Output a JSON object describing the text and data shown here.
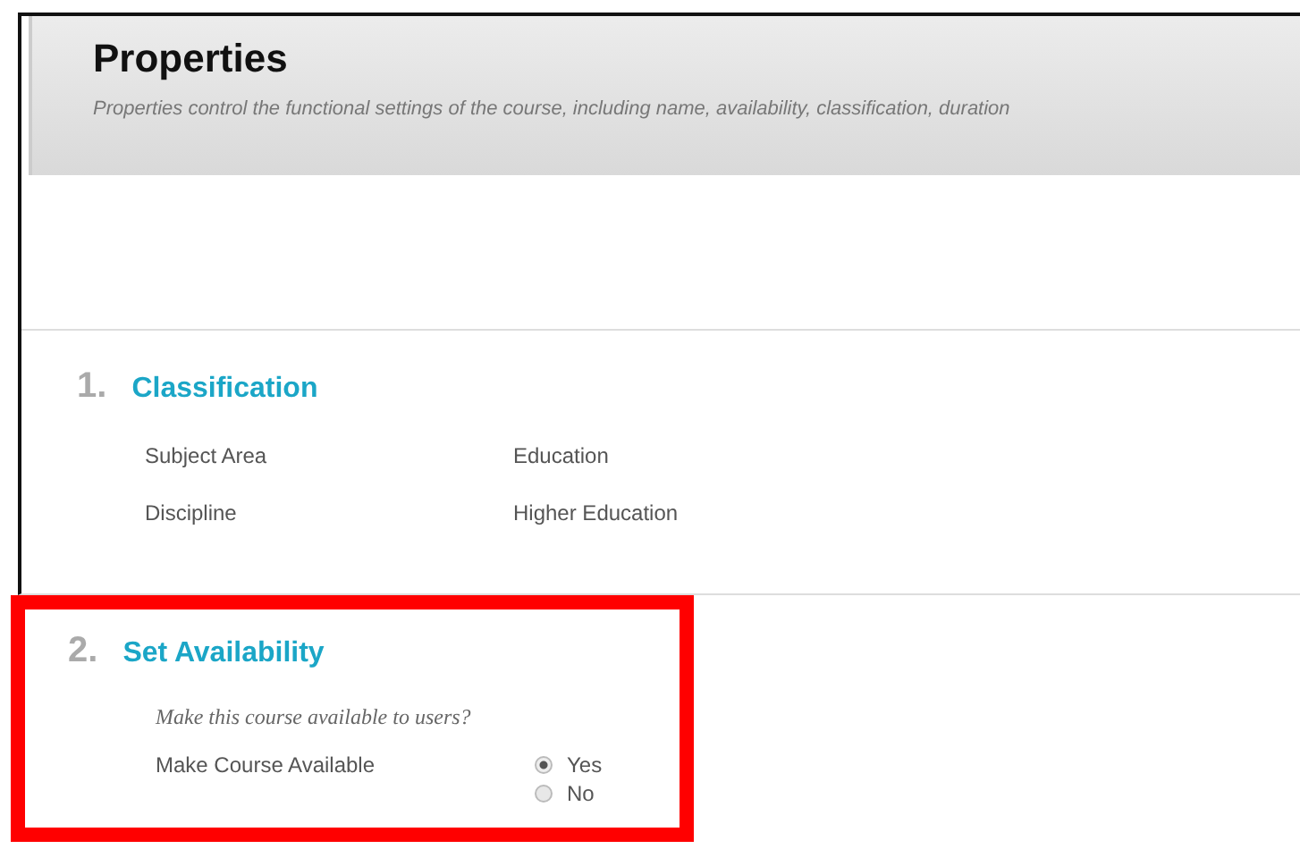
{
  "header": {
    "title": "Properties",
    "description": "Properties control the functional settings of the course, including name, availability, classification, duration"
  },
  "sections": [
    {
      "number": "1.",
      "title": "Classification",
      "highlighted": false,
      "fields": [
        {
          "kind": "text",
          "label": "Subject Area",
          "value": "Education"
        },
        {
          "kind": "text",
          "label": "Discipline",
          "value": "Higher Education"
        }
      ]
    },
    {
      "number": "2.",
      "title": "Set Availability",
      "highlighted": true,
      "prompt": "Make this course available to users?",
      "fields": [
        {
          "kind": "radio",
          "label": "Make Course Available",
          "options": [
            {
              "label": "Yes",
              "selected": true
            },
            {
              "label": "No",
              "selected": false
            }
          ]
        }
      ]
    }
  ]
}
